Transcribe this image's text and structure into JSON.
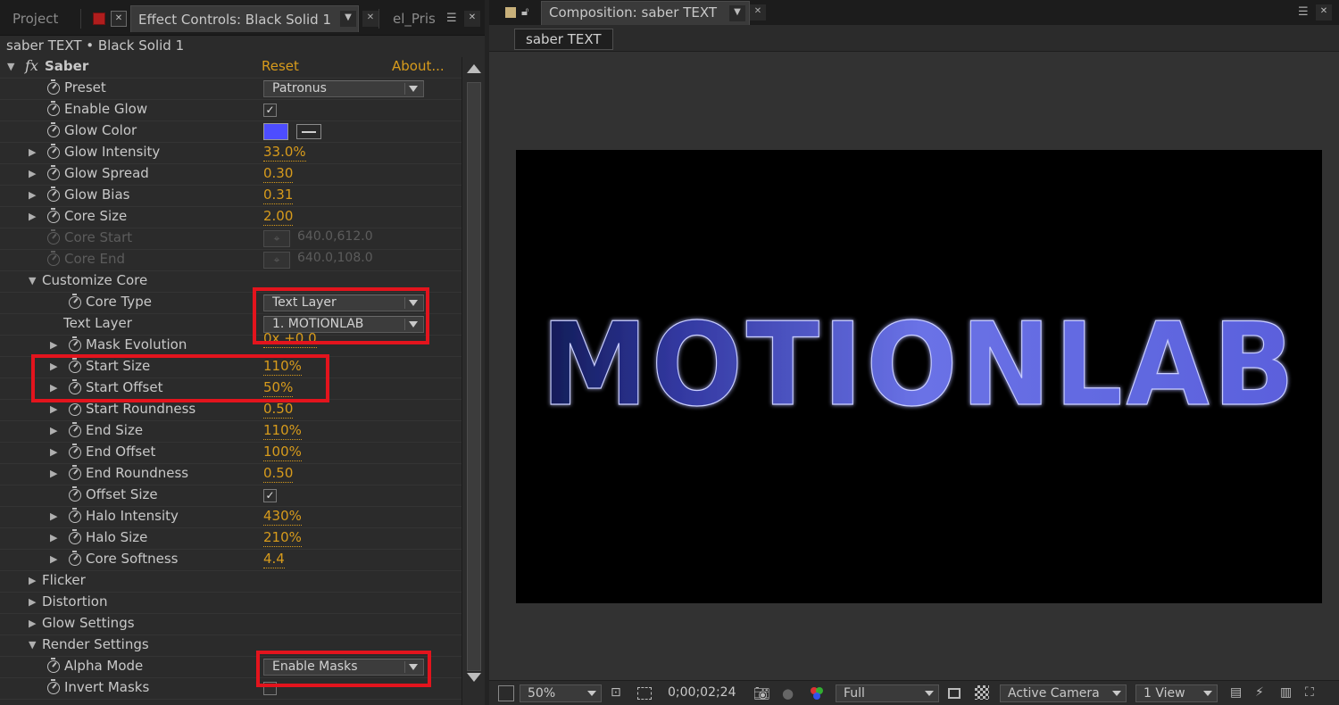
{
  "left_panel": {
    "tabs": {
      "project": "Project",
      "effect_controls": "Effect Controls: Black Solid 1",
      "el_prism": "el_Pris"
    },
    "breadcrumb": "saber TEXT • Black Solid 1",
    "effect": {
      "fx": "fx",
      "name": "Saber",
      "reset": "Reset",
      "about": "About..."
    },
    "rows": {
      "preset": {
        "label": "Preset",
        "value": "Patronus"
      },
      "enable_glow": {
        "label": "Enable Glow",
        "checked": "✓"
      },
      "glow_color": {
        "label": "Glow Color",
        "color": "#4d4dff"
      },
      "glow_intensity": {
        "label": "Glow Intensity",
        "value": "33.0%"
      },
      "glow_spread": {
        "label": "Glow Spread",
        "value": "0.30"
      },
      "glow_bias": {
        "label": "Glow Bias",
        "value": "0.31"
      },
      "core_size": {
        "label": "Core Size",
        "value": "2.00"
      },
      "core_start": {
        "label": "Core Start",
        "value": "640.0,612.0"
      },
      "core_end": {
        "label": "Core End",
        "value": "640.0,108.0"
      },
      "customize_core": {
        "label": "Customize Core"
      },
      "core_type": {
        "label": "Core Type",
        "value": "Text Layer"
      },
      "text_layer": {
        "label": "Text Layer",
        "value": "1. MOTIONLAB"
      },
      "mask_evolution": {
        "label": "Mask Evolution",
        "value": "0x +0.0"
      },
      "start_size": {
        "label": "Start Size",
        "value": "110%"
      },
      "start_offset": {
        "label": "Start Offset",
        "value": "50%"
      },
      "start_roundness": {
        "label": "Start Roundness",
        "value": "0.50"
      },
      "end_size": {
        "label": "End Size",
        "value": "110%"
      },
      "end_offset": {
        "label": "End Offset",
        "value": "100%"
      },
      "end_roundness": {
        "label": "End Roundness",
        "value": "0.50"
      },
      "offset_size": {
        "label": "Offset Size",
        "checked": "✓"
      },
      "halo_intensity": {
        "label": "Halo Intensity",
        "value": "430%"
      },
      "halo_size": {
        "label": "Halo Size",
        "value": "210%"
      },
      "core_softness": {
        "label": "Core Softness",
        "value": "4.4"
      },
      "flicker": {
        "label": "Flicker"
      },
      "distortion": {
        "label": "Distortion"
      },
      "glow_settings": {
        "label": "Glow Settings"
      },
      "render_settings": {
        "label": "Render Settings"
      },
      "alpha_mode": {
        "label": "Alpha Mode",
        "value": "Enable Masks"
      },
      "invert_masks": {
        "label": "Invert Masks",
        "checked": ""
      }
    }
  },
  "right_panel": {
    "tab": "Composition: saber TEXT",
    "subtab": "saber TEXT",
    "canvas_text": "MOTIONLAB",
    "bottom_bar": {
      "zoom": "50%",
      "timecode": "0;00;02;24",
      "resolution": "Full",
      "camera": "Active Camera",
      "views": "1 View"
    }
  },
  "colors": {
    "value_orange": "#d79b1c",
    "highlight_red": "#e3141d",
    "glow_blue": "#4d4dff"
  }
}
